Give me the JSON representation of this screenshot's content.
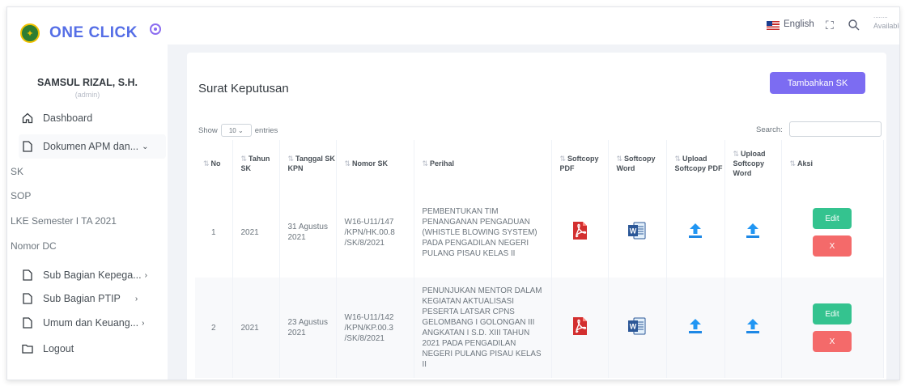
{
  "brand": {
    "name": "ONE CLICK"
  },
  "user": {
    "name": "SAMSUL RIZAL, S.H.",
    "role": "(admin)"
  },
  "sidebar": {
    "items": [
      {
        "label": "Dashboard",
        "icon": "home-icon"
      },
      {
        "label": "Dokumen APM dan...",
        "icon": "file-icon",
        "expanded": true
      },
      {
        "label": "Sub Bagian Kepega...",
        "icon": "file-icon"
      },
      {
        "label": "Sub Bagian PTIP",
        "icon": "file-icon"
      },
      {
        "label": "Umum dan Keuang...",
        "icon": "file-icon"
      },
      {
        "label": "Logout",
        "icon": "folder-icon"
      }
    ],
    "sub_items": [
      "SK",
      "SOP",
      "LKE Semester I TA 2021",
      "Nomor DC"
    ]
  },
  "topbar": {
    "language": "English",
    "status_top": "........",
    "status": "Available"
  },
  "page": {
    "title": "Surat Keputusan",
    "add_button": "Tambahkan SK",
    "show_label": "Show",
    "entries_value": "10",
    "entries_label": "entries",
    "search_label": "Search:"
  },
  "table": {
    "headers": [
      "No",
      "Tahun SK",
      "Tanggal SK KPN",
      "Nomor SK",
      "Perihal",
      "Softcopy PDF",
      "Softcopy Word",
      "Upload Softcopy PDF",
      "Upload Softcopy Word",
      "Aksi"
    ],
    "rows": [
      {
        "no": "1",
        "tahun": "2021",
        "tanggal": "31 Agustus 2021",
        "nomor": "W16-U11/147 /KPN/HK.00.8 /SK/8/2021",
        "perihal": "PEMBENTUKAN TIM PENANGANAN PENGADUAN (WHISTLE BLOWING SYSTEM) PADA PENGADILAN NEGERI PULANG PISAU KELAS II"
      },
      {
        "no": "2",
        "tahun": "2021",
        "tanggal": "23 Agustus 2021",
        "nomor": "W16-U11/142 /KPN/KP.00.3 /SK/8/2021",
        "perihal": "PENUNJUKAN MENTOR DALAM KEGIATAN AKTUALISASI PESERTA LATSAR CPNS GELOMBANG I GOLONGAN III ANGKATAN I S.D. XIII TAHUN 2021 PADA PENGADILAN NEGERI PULANG PISAU KELAS II"
      }
    ],
    "edit_label": "Edit",
    "delete_label": "X"
  },
  "colors": {
    "brand": "#556ee6",
    "primary": "#7c6cf2",
    "success": "#34c38f",
    "danger": "#f46a6a"
  }
}
